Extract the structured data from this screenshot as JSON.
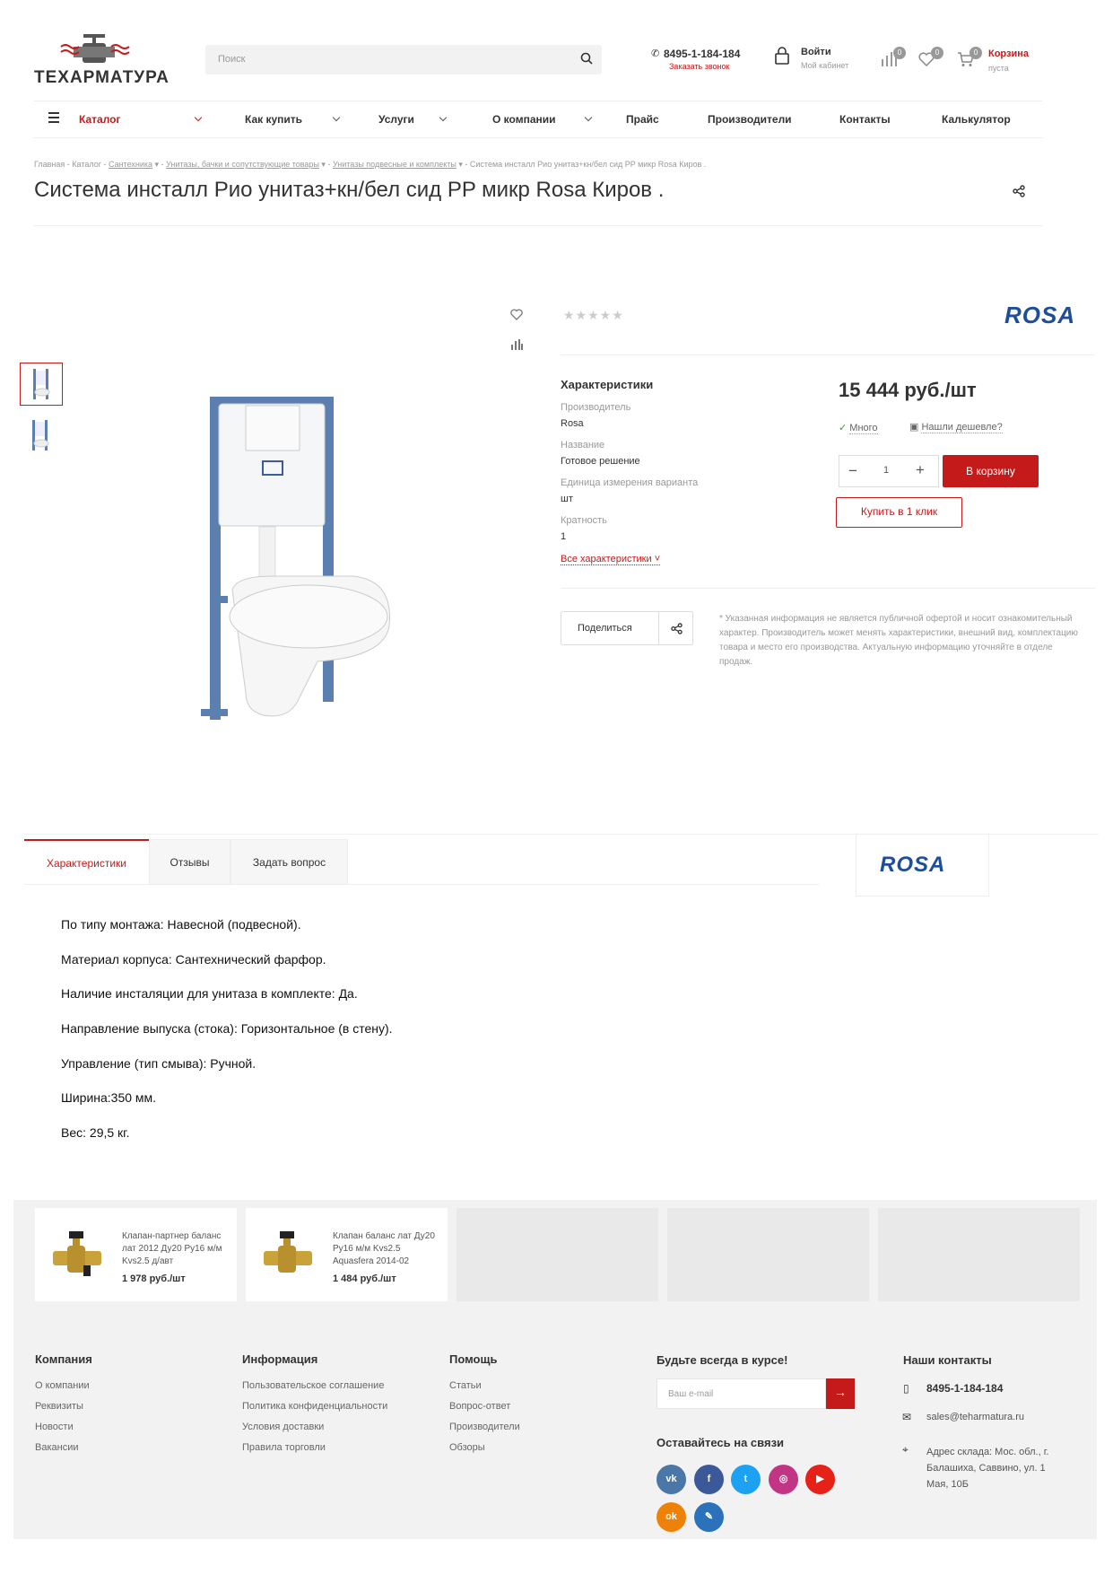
{
  "header": {
    "logo_text": "ТЕХАРМАТУРА",
    "search_placeholder": "Поиск",
    "phone": "8495-1-184-184",
    "callback": "Заказать звонок",
    "login": "Войти",
    "cabinet": "Мой кабинет",
    "compare_count": "0",
    "favorites_count": "0",
    "cart_count": "0",
    "cart_label": "Корзина",
    "cart_status": "пуста"
  },
  "nav": {
    "catalog": "Каталог",
    "items": [
      "Как купить",
      "Услуги",
      "О компании",
      "Прайс",
      "Производители",
      "Контакты",
      "Калькулятор"
    ]
  },
  "breadcrumb": [
    "Главная",
    "Каталог",
    "Сантехника",
    "Унитазы, бачки и сопутствующие товары",
    "Унитазы подвесные и комплекты",
    "Система инсталл Рио унитаз+кн/бел сид PP микр Rosa Киров ."
  ],
  "product": {
    "title": "Система инсталл Рио унитаз+кн/бел сид PP микр Rosa Киров .",
    "brand_logo": "ROSA",
    "rating": 0,
    "characteristics_title": "Характеристики",
    "chars": [
      {
        "label": "Производитель",
        "value": "Rosa"
      },
      {
        "label": "Название",
        "value": "Готовое решение"
      },
      {
        "label": "Единица измерения варианта",
        "value": "шт"
      },
      {
        "label": "Кратность",
        "value": "1"
      }
    ],
    "all_chars": "Все характеристики",
    "price": "15 444 руб./шт",
    "stock": "Много",
    "cheaper": "Нашли дешевле?",
    "qty": "1",
    "to_cart": "В корзину",
    "one_click": "Купить в 1 клик",
    "share": "Поделиться",
    "note": "* Указанная информация не является публичной офертой и носит ознакомительный характер. Производитель может менять характеристики, внешний вид, комплектацию товара и место его производства. Актуальную информацию уточняйте в отделе продаж."
  },
  "tabs": [
    "Характеристики",
    "Отзывы",
    "Задать вопрос"
  ],
  "description": [
    "По типу монтажа: Навесной (подвесной).",
    "Материал корпуса: Сантехнический фарфор.",
    "Наличие инсталяции для унитаза в комплекте: Да.",
    "Направление выпуска (стока): Горизонтальное (в стену).",
    "Управление (тип смыва): Ручной.",
    "Ширина:350 мм.",
    "Вес: 29,5 кг."
  ],
  "related": [
    {
      "name": "Клапан-партнер баланс лат 2012 Ду20 Ру16 м/м Kvs2.5 д/авт",
      "price": "1 978 руб./шт"
    },
    {
      "name": "Клапан баланс лат Ду20 Ру16 м/м Kvs2.5 Aquasfera 2014-02",
      "price": "1 484 руб./шт"
    }
  ],
  "footer": {
    "company": {
      "title": "Компания",
      "links": [
        "О компании",
        "Реквизиты",
        "Новости",
        "Вакансии"
      ]
    },
    "info": {
      "title": "Информация",
      "links": [
        "Пользовательское соглашение",
        "Политика конфиденциальности",
        "Условия доставки",
        "Правила торговли"
      ]
    },
    "help": {
      "title": "Помощь",
      "links": [
        "Статьи",
        "Вопрос-ответ",
        "Производители",
        "Обзоры"
      ]
    },
    "subscribe_title": "Будьте всегда в курсе!",
    "email_placeholder": "Ваш e-mail",
    "social_title": "Оставайтесь на связи",
    "contacts_title": "Наши контакты",
    "phone": "8495-1-184-184",
    "email": "sales@teharmatura.ru",
    "address": "Адрес склада: Мос. обл., г. Балашиха, Саввино, ул. 1 Мая, 10Б"
  },
  "colors": {
    "accent": "#c41a1a",
    "vk": "#4a76a8",
    "fb": "#3b5998",
    "tw": "#1da1f2",
    "ig": "#c13584",
    "yt": "#e62117",
    "ok": "#ee8208",
    "lj": "#2b72ba"
  }
}
